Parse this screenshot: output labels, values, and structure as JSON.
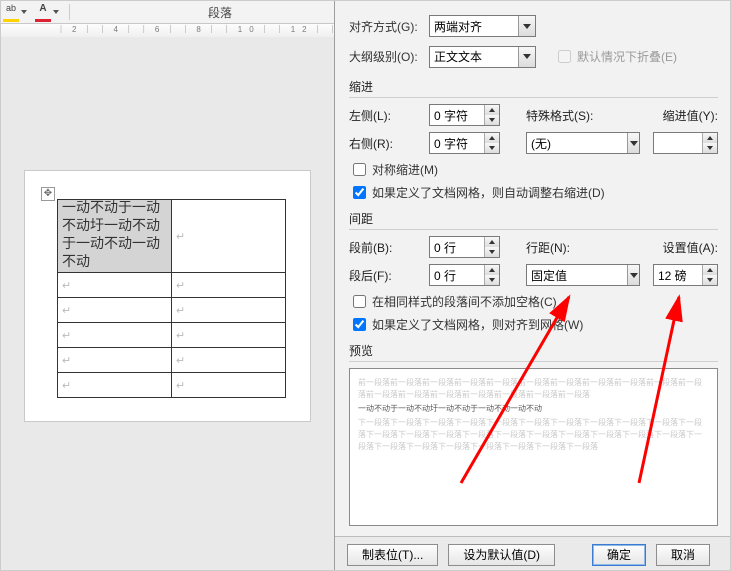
{
  "toolbar": {
    "section_label": "段落"
  },
  "doc": {
    "cell_text": "一动不动于一动不动圩一动不动于一动不动一动不动"
  },
  "dialog": {
    "align_label": "对齐方式(G):",
    "align_value": "两端对齐",
    "outline_label": "大纲级别(O):",
    "outline_value": "正文文本",
    "collapsed_label": "默认情况下折叠(E)",
    "group_indent": "缩进",
    "left_label": "左侧(L):",
    "left_value": "0 字符",
    "right_label": "右侧(R):",
    "right_value": "0 字符",
    "special_label": "特殊格式(S):",
    "special_value": "(无)",
    "indent_val_label": "缩进值(Y):",
    "indent_val_value": "",
    "mirror_label": "对称缩进(M)",
    "grid_indent_label": "如果定义了文档网格，则自动调整右缩进(D)",
    "group_spacing": "间距",
    "before_label": "段前(B):",
    "before_value": "0 行",
    "after_label": "段后(F):",
    "after_value": "0 行",
    "line_spacing_label": "行距(N):",
    "line_spacing_value": "固定值",
    "set_at_label": "设置值(A):",
    "set_at_value": "12 磅",
    "no_space_label": "在相同样式的段落间不添加空格(C)",
    "grid_align_label": "如果定义了文档网格，则对齐到网格(W)",
    "group_preview": "预览",
    "preview_filler": "前一段落前一段落前一段落前一段落前一段落前一段落前一段落前一段落前一段落前一段落前一段落前一段落前一段落前一段落前一段落前一段落前一段落前一段落",
    "preview_main": "一动不动于一动不动圩一动不动于一动不动一动不动",
    "preview_filler2": "下一段落下一段落下一段落下一段落下一段落下一段落下一段落下一段落下一段落下一段落下一段落下一段落下一段落下一段落下一段落下一段落下一段落下一段落下一段落下一段落下一段落下一段落下一段落下一段落下一段落下一段落下一段落下一段落下一段落",
    "tabs_btn": "制表位(T)...",
    "default_btn": "设为默认值(D)",
    "ok_btn": "确定",
    "cancel_btn": "取消"
  }
}
